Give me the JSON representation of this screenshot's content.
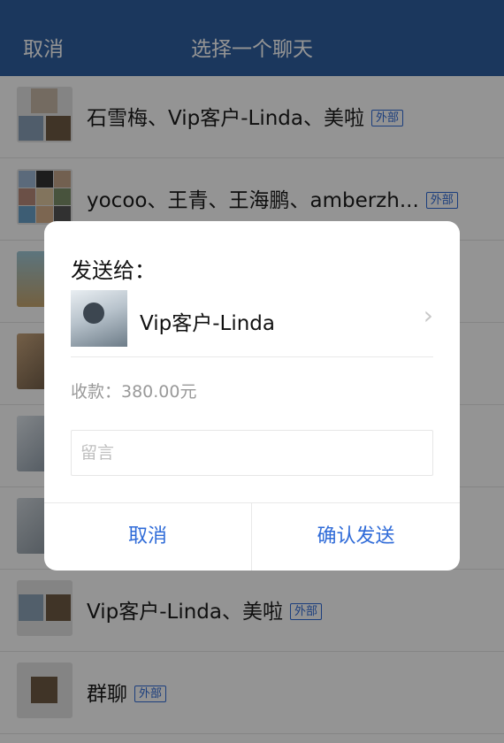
{
  "header": {
    "cancel_label": "取消",
    "title": "选择一个聊天"
  },
  "chat_list": [
    {
      "name": "石雪梅、Vip客户-Linda、美啦",
      "tag": "外部"
    },
    {
      "name": "yocoo、王青、王海鹏、amberzh...",
      "tag": "外部"
    },
    {
      "name": "",
      "tag": ""
    },
    {
      "name": "",
      "tag": ""
    },
    {
      "name": "",
      "tag": ""
    },
    {
      "name": "",
      "tag": ""
    },
    {
      "name": "Vip客户-Linda、美啦",
      "tag": "外部"
    },
    {
      "name": "群聊",
      "tag": "外部"
    }
  ],
  "dialog": {
    "title": "发送给：",
    "recipient_name": "Vip客户-Linda",
    "amount_text": "收款：380.00元",
    "note_placeholder": "留言",
    "cancel_label": "取消",
    "confirm_label": "确认发送",
    "accent_color": "#2f6bd8"
  },
  "colors": {
    "header_bg": "#2f5fa0",
    "tag_color": "#2f6bd8"
  }
}
